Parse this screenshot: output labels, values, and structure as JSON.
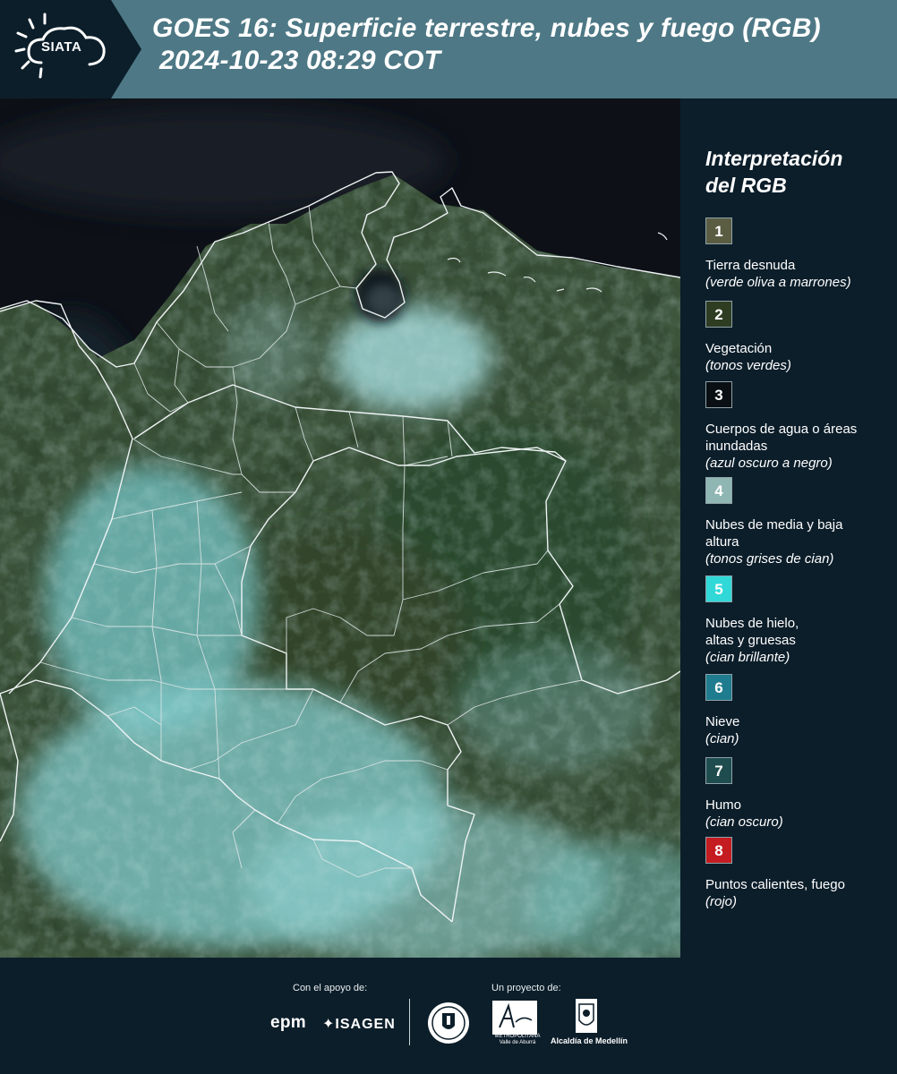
{
  "header": {
    "logo_text": "SIATA",
    "title_line1": "GOES 16: Superficie terrestre, nubes y fuego (RGB)",
    "title_line2": "2024-10-23 08:29 COT"
  },
  "legend": {
    "title_line1": "Interpretación",
    "title_line2": "del RGB",
    "items": [
      {
        "number": "1",
        "color": "#5b5d43",
        "label": "Tierra desnuda",
        "note": "(verde oliva a marrones)"
      },
      {
        "number": "2",
        "color": "#2e3d22",
        "label": "Vegetación",
        "note": "(tonos verdes)"
      },
      {
        "number": "3",
        "color": "#0a0f14",
        "label": "Cuerpos de agua o áreas inundadas",
        "note": "(azul oscuro a negro)"
      },
      {
        "number": "4",
        "color": "#8fb6b3",
        "label": "Nubes de media y baja altura",
        "note": "(tonos grises de cian)"
      },
      {
        "number": "5",
        "color": "#30d8d8",
        "label": "Nubes de hielo, altas y gruesas",
        "note": "(cian brillante)"
      },
      {
        "number": "6",
        "color": "#1f7c8e",
        "label": "Nieve",
        "note": "(cian)"
      },
      {
        "number": "7",
        "color": "#1f4d4f",
        "label": "Humo",
        "note": "(cian oscuro)"
      },
      {
        "number": "8",
        "color": "#c41c20",
        "label": "Puntos calientes, fuego",
        "note": "(rojo)"
      }
    ]
  },
  "footer": {
    "support_label": "Con el apoyo de:",
    "project_label": "Un proyecto de:",
    "epm": "epm",
    "isagen": "ISAGEN",
    "metro_text": "METROPOLITANA Valle de Aburrá",
    "medellin": "Alcaldía de Medellín"
  },
  "colors": {
    "header_bg": "#4e7885",
    "page_bg": "#0c1e2a",
    "map_ocean": "#0d1117",
    "map_land": "#2c4029",
    "map_cloud": "#7cc9cb",
    "borders": "#e8eef0"
  }
}
